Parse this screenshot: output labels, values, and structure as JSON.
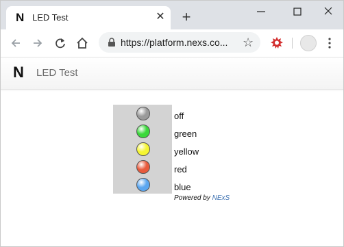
{
  "browser": {
    "tab_title": "LED Test",
    "tab_favicon": "N",
    "url": "https://platform.nexs.co..."
  },
  "app": {
    "logo": "N",
    "title": "LED Test"
  },
  "leds": [
    {
      "label": "off",
      "color": "#9a9a9a"
    },
    {
      "label": "green",
      "color": "#3ad83a"
    },
    {
      "label": "yellow",
      "color": "#f5f532"
    },
    {
      "label": "red",
      "color": "#e85a3c"
    },
    {
      "label": "blue",
      "color": "#5aa6f0"
    }
  ],
  "footer": {
    "powered_prefix": "Powered by",
    "powered_link": "NExS"
  }
}
